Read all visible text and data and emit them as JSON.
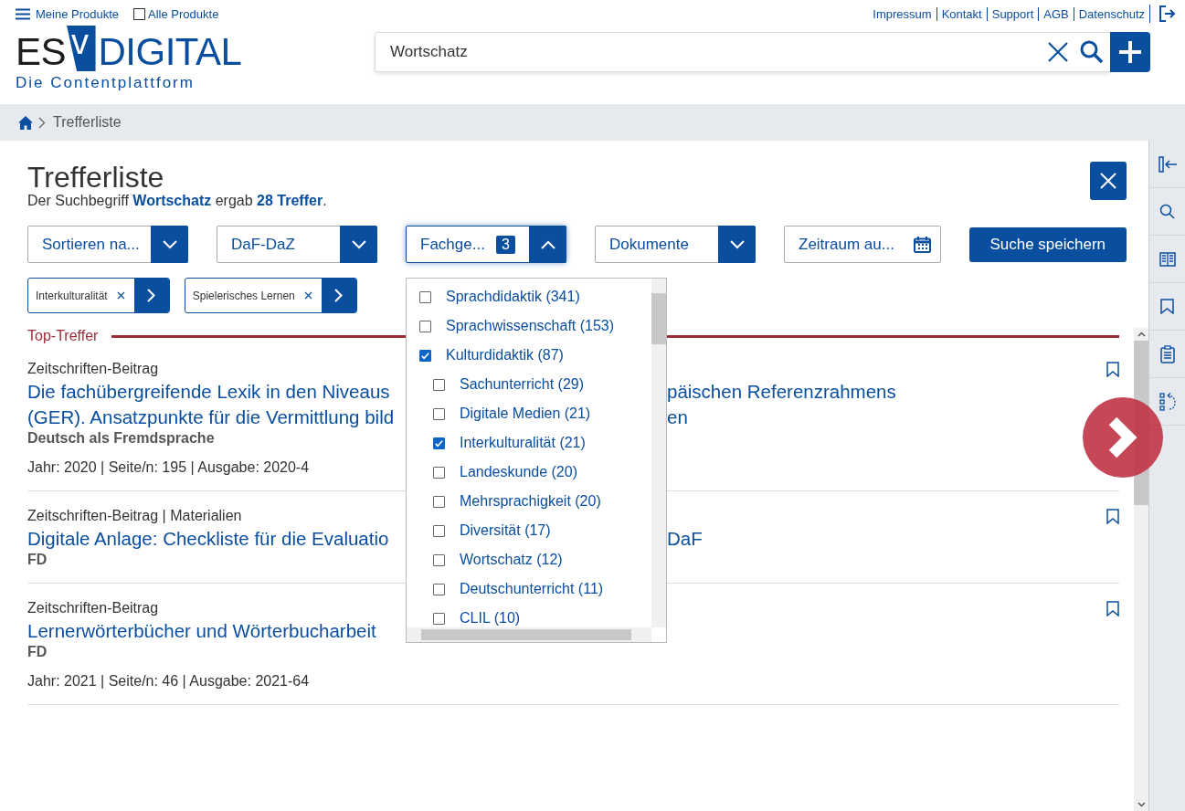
{
  "header": {
    "menu_link": "Meine Produkte",
    "all_products": {
      "label": "Alle Produkte",
      "checked": false
    },
    "links": [
      "Impressum",
      "Kontakt",
      "Support",
      "AGB",
      "Datenschutz"
    ]
  },
  "logo": {
    "left": "ES",
    "mark": "v",
    "right": "DIGITAL",
    "tagline": "Die Contentplattform"
  },
  "search": {
    "value": "Wortschatz"
  },
  "breadcrumb": {
    "current": "Trefferliste"
  },
  "page": {
    "title": "Trefferliste",
    "summary": "Der Suchbegriff **Wortschatz** ergab **28 Treffer**."
  },
  "filters": [
    {
      "kind": "select",
      "label": "Sortieren na...",
      "expanded": false
    },
    {
      "kind": "select",
      "label": "DaF-DaZ",
      "expanded": false
    },
    {
      "kind": "select",
      "label": "Fachge...",
      "count": "3",
      "expanded": true
    },
    {
      "kind": "select",
      "label": "Dokumente",
      "expanded": false
    },
    {
      "kind": "date",
      "label": "Zeitraum au..."
    },
    {
      "kind": "button",
      "label": "Suche speichern"
    }
  ],
  "chips": [
    "Interkulturalität",
    "Spielerisches Lernen"
  ],
  "dropdown": {
    "items": [
      {
        "label": "Sprachdidaktik (341)",
        "checked": false
      },
      {
        "label": "Sprachwissenschaft (153)",
        "checked": false
      },
      {
        "label": "Kulturdidaktik (87)",
        "checked": true,
        "children": [
          {
            "label": "Sachunterricht (29)",
            "checked": false
          },
          {
            "label": "Digitale Medien (21)",
            "checked": false
          },
          {
            "label": "Interkulturalität (21)",
            "checked": true
          },
          {
            "label": "Landeskunde (20)",
            "checked": false
          },
          {
            "label": "Mehrsprachigkeit (20)",
            "checked": false
          },
          {
            "label": "Diversität (17)",
            "checked": false
          },
          {
            "label": "Wortschatz (12)",
            "checked": false
          },
          {
            "label": "Deutschunterricht (11)",
            "checked": false
          },
          {
            "label": "CLIL (10)",
            "checked": false
          }
        ]
      }
    ]
  },
  "section_title": "Top-Treffer",
  "results": [
    {
      "type": "Zeitschriften-Beitrag",
      "title_lines": [
        [
          "Die fachübergreifende Lexik in den Niveaus",
          "päischen Referenzrahmens"
        ],
        [
          "(GER). Ansatzpunkte für die Vermittlung bild",
          "en"
        ]
      ],
      "source": "Deutsch als Fremdsprache",
      "meta": "Jahr: 2020 | Seite/n: 195 | Ausgabe: 2020-4"
    },
    {
      "type": "Zeitschriften-Beitrag | Materialien",
      "title_lines": [
        [
          "Digitale Anlage: Checkliste für die Evaluatio",
          "DaF"
        ]
      ],
      "source": "FD"
    },
    {
      "type": "Zeitschriften-Beitrag",
      "title_lines": [
        [
          "Lernerwörterbücher und Wörterbucharbeit"
        ]
      ],
      "source": "FD",
      "meta": "Jahr: 2021 | Seite/n: 46 | Ausgabe: 2021-64"
    }
  ]
}
